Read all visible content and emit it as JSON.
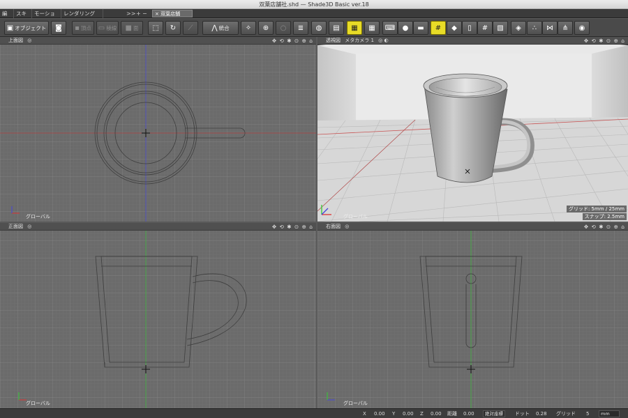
{
  "window": {
    "title": "双葉店舗社.shd — Shade3D Basic ver.18"
  },
  "menu_tabs": [
    "編集",
    "スキン",
    "モーション",
    "レンダリング"
  ],
  "tab_controls": {
    "expand": ">>",
    "add": "+",
    "remove": "−"
  },
  "document_tab": {
    "close": "×",
    "name": "双葉店舗社.shd"
  },
  "toolbar": {
    "mode_label": "オブジェクト",
    "vertex_label": "頂点",
    "edge_label": "稜線",
    "face_label": "面",
    "merge_label": "統合"
  },
  "viewports": {
    "top": {
      "title": "上面図",
      "label": "グローバル"
    },
    "perspective": {
      "title": "透視図",
      "camera": "メタカメラ 1",
      "grid_info": "グリッド: 5mm / 25mm",
      "snap_info": "スナップ: 2.5mm",
      "label": "グローバル"
    },
    "front": {
      "title": "正面図",
      "label": "グローバル"
    },
    "right": {
      "title": "右面図",
      "label": "グローバル"
    }
  },
  "status": {
    "x_label": "X",
    "x_value": "0.00",
    "y_label": "Y",
    "y_value": "0.00",
    "z_label": "Z",
    "z_value": "0.00",
    "dist_label": "距離",
    "dist_value": "0.00",
    "coord_mode": "絶対座標",
    "dot_label": "ドット",
    "dot_value": "0.28",
    "grid_label": "グリッド",
    "grid_value": "5",
    "unit": "mm"
  }
}
